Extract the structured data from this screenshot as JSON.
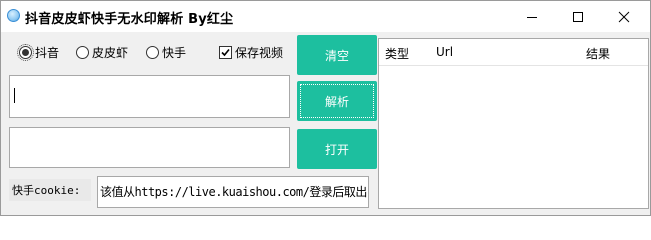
{
  "window": {
    "title": "抖音皮皮虾快手无水印解析 By红尘"
  },
  "options": {
    "radios": [
      {
        "label": "抖音",
        "checked": true
      },
      {
        "label": "皮皮虾",
        "checked": false
      },
      {
        "label": "快手",
        "checked": false
      }
    ],
    "save_video": {
      "label": "保存视频",
      "checked": true
    }
  },
  "buttons": {
    "clear": "清空",
    "parse": "解析",
    "open": "打开"
  },
  "cookie": {
    "label": "快手cookie:",
    "value": "该值从https://live.kuaishou.com/登录后取出"
  },
  "results": {
    "columns": [
      "类型",
      "Url",
      "结果"
    ],
    "rows": []
  },
  "colors": {
    "accent": "#1dbf9f"
  }
}
